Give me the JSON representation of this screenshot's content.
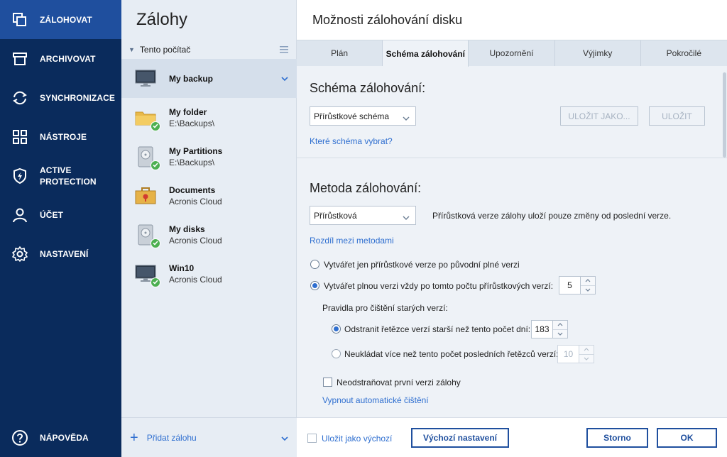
{
  "nav": {
    "items": [
      {
        "label": "ZÁLOHOVAT",
        "icon": "backup-copy-icon",
        "active": true
      },
      {
        "label": "ARCHIVOVAT",
        "icon": "archive-box-icon"
      },
      {
        "label": "SYNCHRONIZACE",
        "icon": "sync-arrows-icon"
      },
      {
        "label": "NÁSTROJE",
        "icon": "tools-grid-icon"
      },
      {
        "label": "ACTIVE PROTECTION",
        "icon": "shield-bolt-icon"
      },
      {
        "label": "ÚČET",
        "icon": "person-icon"
      },
      {
        "label": "NASTAVENÍ",
        "icon": "gear-icon"
      }
    ],
    "help": "NÁPOVĚDA"
  },
  "list": {
    "title": "Zálohy",
    "group": "Tento počítač",
    "items": [
      {
        "name": "My backup",
        "sub": "",
        "icon": "monitor-icon",
        "selected": true
      },
      {
        "name": "My folder",
        "sub": "E:\\Backups\\",
        "icon": "folder-icon",
        "ok": true
      },
      {
        "name": "My Partitions",
        "sub": "E:\\Backups\\",
        "icon": "disk-icon",
        "ok": true
      },
      {
        "name": "Documents",
        "sub": "Acronis Cloud",
        "icon": "briefcase-icon"
      },
      {
        "name": "My disks",
        "sub": "Acronis Cloud",
        "icon": "disk-icon",
        "ok": true
      },
      {
        "name": "Win10",
        "sub": "Acronis Cloud",
        "icon": "monitor-icon",
        "ok": true
      }
    ],
    "add": "Přidat zálohu"
  },
  "dialog": {
    "title": "Možnosti zálohování disku",
    "tabs": [
      "Plán",
      "Schéma zálohování",
      "Upozornění",
      "Výjimky",
      "Pokročilé"
    ],
    "active_tab": 1,
    "scheme": {
      "heading": "Schéma zálohování:",
      "selected": "Přírůstkové schéma",
      "save_as": "ULOŽIT JAKO...",
      "save": "ULOŽIT",
      "link": "Které schéma vybrat?"
    },
    "method": {
      "heading": "Metoda zálohování:",
      "selected": "Přírůstková",
      "description": "Přírůstková verze zálohy uloží pouze změny od poslední verze.",
      "link": "Rozdíl mezi metodami",
      "option1": "Vytvářet jen přírůstkové verze po původní plné verzi",
      "option2": "Vytvářet plnou verzi vždy po tomto počtu přírůstkových verzí:",
      "option2_value": "5",
      "cleanup_label": "Pravidla pro čištění starých verzí:",
      "cleanup1": "Odstranit řetězce verzí starší než tento počet dní:",
      "cleanup1_value": "183",
      "cleanup2": "Neukládat více než tento počet posledních řetězců verzí:",
      "cleanup2_value": "10",
      "keep_first": "Neodstraňovat první verzi zálohy",
      "disable_link": "Vypnout automatické čištění"
    },
    "footer": {
      "save_default": "Uložit jako výchozí",
      "defaults": "Výchozí nastavení",
      "cancel": "Storno",
      "ok": "OK"
    }
  },
  "colors": {
    "nav_bg": "#0a2b5c",
    "nav_active": "#1f4f9e",
    "accent": "#2f6fd0",
    "ok_green": "#4caf50"
  }
}
